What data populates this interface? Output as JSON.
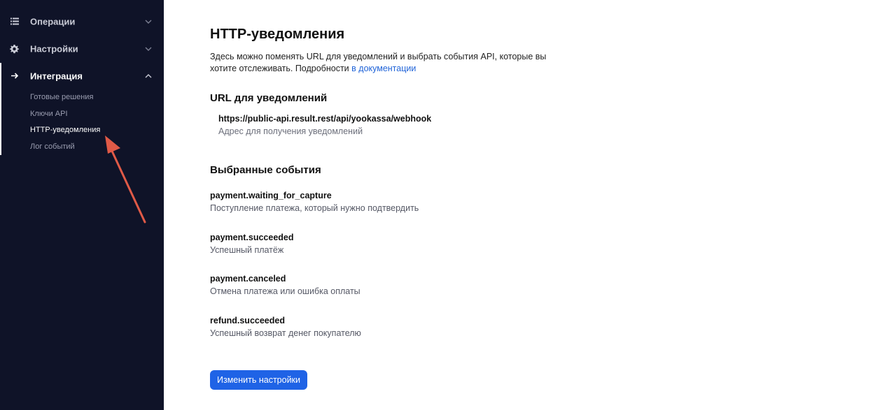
{
  "sidebar": {
    "groups": [
      {
        "label": "Операции",
        "icon": "list-icon",
        "expanded": false
      },
      {
        "label": "Настройки",
        "icon": "gear-icon",
        "expanded": false
      },
      {
        "label": "Интеграция",
        "icon": "arrow-right-icon",
        "expanded": true
      }
    ],
    "subitems": [
      {
        "label": "Готовые решения",
        "active": false
      },
      {
        "label": "Ключи API",
        "active": false
      },
      {
        "label": "HTTP-уведомления",
        "active": true
      },
      {
        "label": "Лог событий",
        "active": false
      }
    ]
  },
  "main": {
    "title": "HTTP-уведомления",
    "description": "Здесь можно поменять URL для уведомлений и выбрать события API, которые вы хотите отслеживать. Подробности",
    "docs_link": "в документации",
    "url_section": {
      "heading": "URL для уведомлений",
      "url": "https://public-api.result.rest/api/yookassa/webhook",
      "hint": "Адрес для получения уведомлений"
    },
    "events_section": {
      "heading": "Выбранные события",
      "events": [
        {
          "name": "payment.waiting_for_capture",
          "desc": "Поступление платежа, который нужно подтвердить"
        },
        {
          "name": "payment.succeeded",
          "desc": "Успешный платёж"
        },
        {
          "name": "payment.canceled",
          "desc": "Отмена платежа или ошибка оплаты"
        },
        {
          "name": "refund.succeeded",
          "desc": "Успешный возврат денег покупателю"
        }
      ]
    },
    "button_label": "Изменить настройки"
  },
  "colors": {
    "sidebar_bg": "#0f1328",
    "accent": "#1f63e6",
    "annotation_arrow": "#e05a47"
  }
}
